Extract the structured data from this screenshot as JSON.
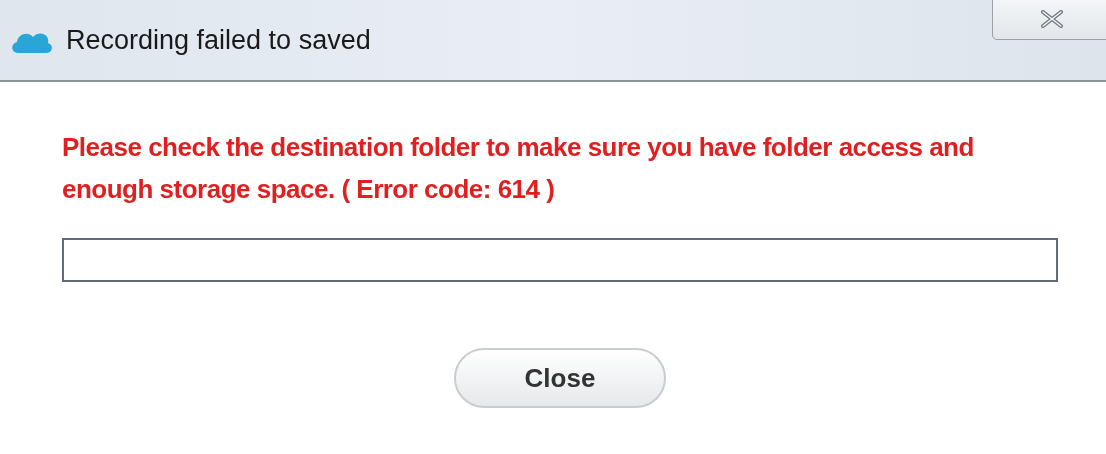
{
  "window": {
    "title": "Recording failed to saved"
  },
  "message": "Please check the destination folder to make sure you have folder access and enough storage space. ( Error code: 614 )",
  "buttons": [
    {
      "label": "Close"
    }
  ]
}
